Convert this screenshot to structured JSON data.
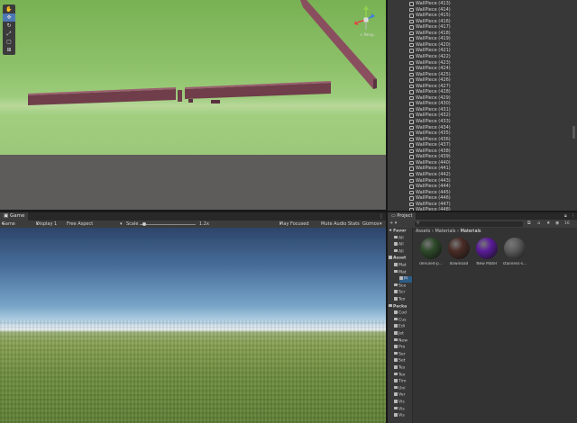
{
  "scene": {
    "tools": [
      "hand-icon",
      "move-icon",
      "rotate-icon",
      "scale-icon",
      "rect-icon",
      "transform-icon"
    ],
    "gizmo_label": "< Persp"
  },
  "game": {
    "tab_label": "Game",
    "toolbar": {
      "game_dropdown": "Game",
      "display": "Display 1",
      "aspect": "Free Aspect",
      "scale_label": "Scale",
      "scale_value": "1.2x",
      "play_focused": "Play Focused",
      "mute_audio": "Mute Audio",
      "stats": "Stats",
      "gizmos": "Gizmos"
    }
  },
  "hierarchy": {
    "items": [
      "WallPiece (413)",
      "WallPiece (414)",
      "WallPiece (415)",
      "WallPiece (416)",
      "WallPiece (417)",
      "WallPiece (418)",
      "WallPiece (419)",
      "WallPiece (420)",
      "WallPiece (421)",
      "WallPiece (422)",
      "WallPiece (423)",
      "WallPiece (424)",
      "WallPiece (425)",
      "WallPiece (426)",
      "WallPiece (427)",
      "WallPiece (428)",
      "WallPiece (429)",
      "WallPiece (430)",
      "WallPiece (431)",
      "WallPiece (432)",
      "WallPiece (433)",
      "WallPiece (434)",
      "WallPiece (435)",
      "WallPiece (436)",
      "WallPiece (437)",
      "WallPiece (438)",
      "WallPiece (439)",
      "WallPiece (440)",
      "WallPiece (441)",
      "WallPiece (442)",
      "WallPiece (443)",
      "WallPiece (444)",
      "WallPiece (445)",
      "WallPiece (446)",
      "WallPiece (447)",
      "WallPiece (448)"
    ]
  },
  "project": {
    "tab_label": "Project",
    "count_badge": "16",
    "tree": [
      {
        "label": "Favor",
        "indent": 0,
        "bold": true
      },
      {
        "label": "All",
        "indent": 1
      },
      {
        "label": "All",
        "indent": 1
      },
      {
        "label": "All",
        "indent": 1
      },
      {
        "label": "Asset",
        "indent": 0,
        "bold": true
      },
      {
        "label": "Mat",
        "indent": 1
      },
      {
        "label": "Mat",
        "indent": 1
      },
      {
        "label": "M",
        "indent": 2,
        "selected": true
      },
      {
        "label": "Sce",
        "indent": 1
      },
      {
        "label": "Scr",
        "indent": 1
      },
      {
        "label": "Tex",
        "indent": 1
      },
      {
        "label": "Packa",
        "indent": 0,
        "bold": true
      },
      {
        "label": "Cod",
        "indent": 1
      },
      {
        "label": "Cus",
        "indent": 1
      },
      {
        "label": "Edi",
        "indent": 1
      },
      {
        "label": "Jet",
        "indent": 1
      },
      {
        "label": "New",
        "indent": 1
      },
      {
        "label": "Pro",
        "indent": 1
      },
      {
        "label": "Ser",
        "indent": 1
      },
      {
        "label": "Set",
        "indent": 1
      },
      {
        "label": "Tes",
        "indent": 1
      },
      {
        "label": "Tex",
        "indent": 1
      },
      {
        "label": "Tim",
        "indent": 1
      },
      {
        "label": "Uni",
        "indent": 1
      },
      {
        "label": "Ver",
        "indent": 1
      },
      {
        "label": "Vis",
        "indent": 1
      },
      {
        "label": "Vis",
        "indent": 1
      },
      {
        "label": "Vis",
        "indent": 1
      }
    ],
    "breadcrumb": [
      "Assets",
      "Materials",
      "Materials"
    ],
    "assets": [
      {
        "name": "denuled-p...",
        "color": "#2e4a2a"
      },
      {
        "name": "download",
        "color": "#4a2c26"
      },
      {
        "name": "New Mater",
        "color": "#5a1c9a"
      },
      {
        "name": "stainless-s...",
        "color": "#5b5b5b"
      }
    ]
  }
}
